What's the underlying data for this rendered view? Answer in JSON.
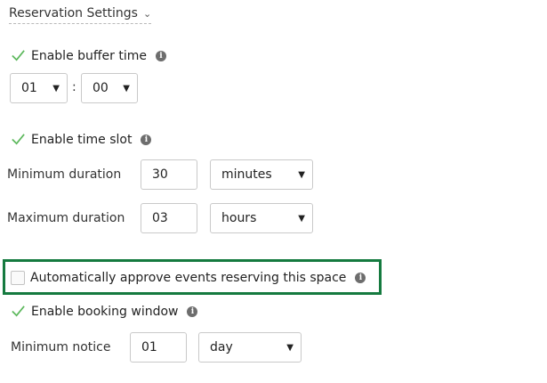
{
  "header": {
    "title": "Reservation Settings",
    "chevron": "chevron-down-icon"
  },
  "buffer": {
    "label": "Enable buffer time",
    "hours": "01",
    "separator": ":",
    "minutes": "00"
  },
  "time_slot": {
    "label": "Enable time slot",
    "min_label": "Minimum duration",
    "min_value": "30",
    "min_unit": "minutes",
    "max_label": "Maximum duration",
    "max_value": "03",
    "max_unit": "hours"
  },
  "auto_approve": {
    "label": "Automatically approve events reserving this space",
    "checked": false
  },
  "booking_window": {
    "label": "Enable booking window",
    "notice_label": "Minimum notice",
    "notice_value": "01",
    "notice_unit": "day"
  },
  "colors": {
    "check": "#5cb85c",
    "highlight": "#157a3f",
    "border": "#c9c9c9"
  }
}
